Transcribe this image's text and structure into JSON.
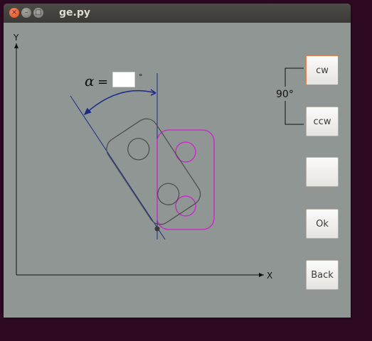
{
  "window": {
    "title": "ge.py"
  },
  "titlebar_buttons": {
    "close_icon": "×",
    "minimize_icon": "–",
    "maximize_icon": "□"
  },
  "canvas": {
    "x_axis_label": "X",
    "y_axis_label": "Y",
    "alpha_symbol": "α",
    "equals": "=",
    "degree_symbol": "°",
    "rotation_label": "90°",
    "angle_value": ""
  },
  "buttons": {
    "cw": "cw",
    "ccw": "ccw",
    "blank": "",
    "ok": "Ok",
    "back": "Back"
  },
  "colors": {
    "window_bg": "#8f9694",
    "reference_line": "#1d2b86",
    "rotated_shape": "#4a4a4a",
    "original_shape": "#d020d0",
    "cw_border": "#e2844e"
  }
}
